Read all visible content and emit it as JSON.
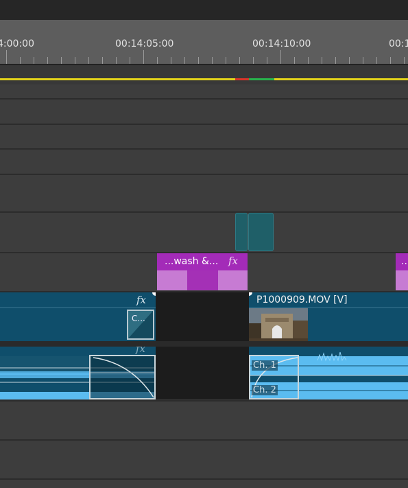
{
  "ruler": {
    "timecodes": [
      "4:00:00",
      "00:14:05:00",
      "00:14:10:00",
      "00:1"
    ]
  },
  "workarea": {
    "colors": {
      "main": "#e3d21a",
      "red": "#d8352a",
      "green": "#28b34c"
    }
  },
  "title_clip": {
    "label": "...wash &...",
    "fx": "fx",
    "next_label": "..."
  },
  "video_track": {
    "clip_left_fx": "fx",
    "transition_label": "C...",
    "clip_right_name": "P1000909.MOV [V]"
  },
  "audio_track": {
    "ch1": "Ch. 1",
    "ch2": "Ch. 2",
    "fx": "fx"
  },
  "colors": {
    "video_clip": "#0f4e6b",
    "title_clip": "#a32bb8",
    "waveform": "#5bbcf0"
  }
}
